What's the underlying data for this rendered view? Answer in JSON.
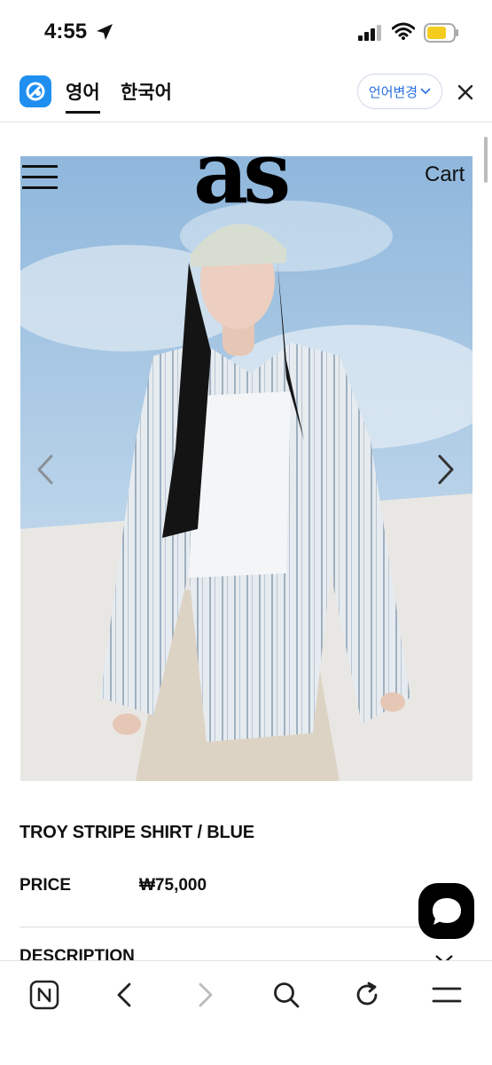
{
  "status": {
    "time": "4:55"
  },
  "translate_bar": {
    "tabs": [
      "영어",
      "한국어"
    ],
    "active_tab": "영어",
    "change_language_label": "언어변경",
    "accent_color": "#1e8ff0"
  },
  "site": {
    "brand": "as",
    "cart_label": "Cart"
  },
  "product": {
    "name": "TROY STRIPE SHIRT / BLUE",
    "price_label": "PRICE",
    "price_value": "₩75,000",
    "description_label": "DESCRIPTION"
  },
  "icons": {
    "status": [
      "location-arrow-icon",
      "signal-icon",
      "wifi-icon",
      "battery-icon"
    ],
    "toolbar": [
      "naver-home-icon",
      "back-icon",
      "forward-icon",
      "search-icon",
      "refresh-icon",
      "menu-icon"
    ]
  }
}
